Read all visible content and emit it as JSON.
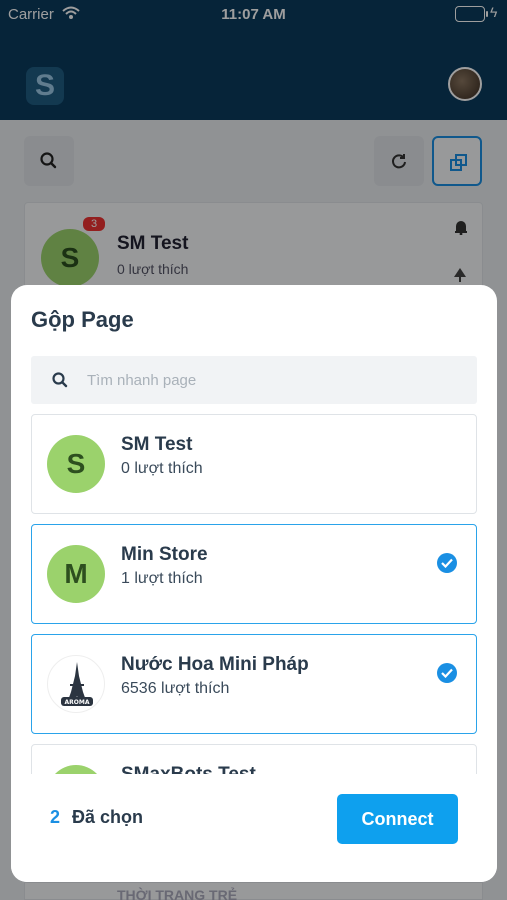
{
  "status_bar": {
    "carrier": "Carrier",
    "time": "11:07 AM"
  },
  "app": {
    "logo_letter": "S"
  },
  "background_page": {
    "avatar_letter": "S",
    "badge": "3",
    "name": "SM Test",
    "likes": "0 lượt thích",
    "bottom_text": "THỜI TRANG TRẺ"
  },
  "modal": {
    "title": "Gộp Page",
    "search_placeholder": "Tìm nhanh page",
    "pages": [
      {
        "avatar": "S",
        "name": "SM Test",
        "likes": "0 lượt thích",
        "selected": false
      },
      {
        "avatar": "M",
        "name": "Min Store",
        "likes": "1 lượt thích",
        "selected": true
      },
      {
        "avatar": "AROMA",
        "name": "Nước Hoa Mini Pháp",
        "likes": "6536 lượt thích",
        "selected": true
      },
      {
        "avatar": "",
        "name": "SMaxBots Test",
        "likes": "",
        "selected": false
      }
    ],
    "selected_count": "2",
    "selected_label": "Đã chọn",
    "connect_label": "Connect"
  },
  "colors": {
    "accent": "#1a8fe3",
    "header": "#0a3a5c",
    "avatar_green": "#9bd26c",
    "connect": "#0ea0ee"
  }
}
